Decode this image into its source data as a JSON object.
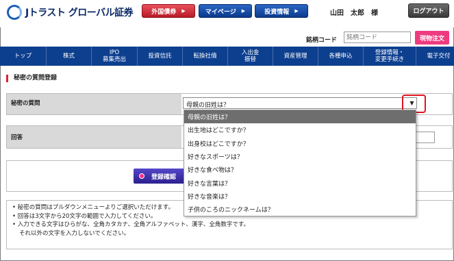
{
  "header": {
    "logo_text": "Jトラスト グローバル証券",
    "buttons": [
      {
        "label": "外国債券",
        "icon": "play-arrow-icon"
      },
      {
        "label": "マイページ",
        "icon": "play-arrow-icon"
      },
      {
        "label": "投資情報",
        "icon": "play-arrow-icon"
      }
    ],
    "user": "山田　太郎　様",
    "logout": "ログアウト"
  },
  "search": {
    "label": "銘柄コード",
    "placeholder": "銘柄コード",
    "buy_button": "現物注文"
  },
  "nav": [
    "トップ",
    "株式",
    "IPO\n募集売出",
    "投資信託",
    "転換社債",
    "入出金\n振替",
    "資産管理",
    "各種申込",
    "登録情報・\n変更手続き",
    "電子交付"
  ],
  "page_title": "秘密の質問登録",
  "form": {
    "question_label": "秘密の質問",
    "question_selected": "母親の旧姓は？",
    "answer_label": "回答",
    "confirm_button": "登録確認"
  },
  "dropdown_options": [
    "母親の旧姓は？",
    "出生地はどこですか？",
    "出身校はどこですか？",
    "好きなスポーツは？",
    "好きな食べ物は？",
    "好きな言葉は？",
    "好きな音楽は？",
    "子供のころのニックネームは？"
  ],
  "notes": [
    "秘密の質問はプルダウンメニューよりご選択いただけます。",
    "回答は3文字から20文字の範囲で入力してください。",
    "入力できる文字はひらがな、全角カタカナ、全角アルファベット、漢字、全角数字です。",
    "それ以外の文字を入力しないでください。"
  ],
  "colors": {
    "nav_bg": "#0d3f8f",
    "accent_red": "#d8203a",
    "buy_pink": "#ee3b7f",
    "highlight": "#e0141e"
  }
}
